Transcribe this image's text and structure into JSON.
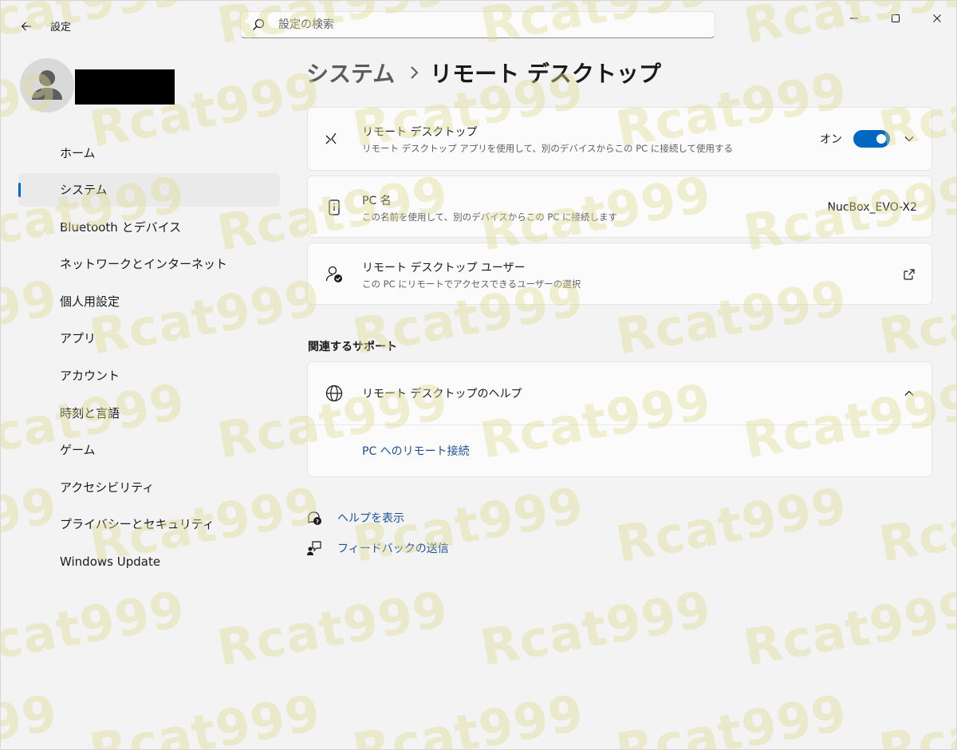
{
  "window": {
    "title": "設定"
  },
  "search": {
    "placeholder": "設定の検索"
  },
  "profile": {
    "name": ""
  },
  "sidebar": {
    "items": [
      {
        "label": "ホーム"
      },
      {
        "label": "システム",
        "selected": true
      },
      {
        "label": "Bluetooth とデバイス"
      },
      {
        "label": "ネットワークとインターネット"
      },
      {
        "label": "個人用設定"
      },
      {
        "label": "アプリ"
      },
      {
        "label": "アカウント"
      },
      {
        "label": "時刻と言語"
      },
      {
        "label": "ゲーム"
      },
      {
        "label": "アクセシビリティ"
      },
      {
        "label": "プライバシーとセキュリティ"
      },
      {
        "label": "Windows Update"
      }
    ]
  },
  "breadcrumb": {
    "parent": "システム",
    "current": "リモート デスクトップ"
  },
  "settings": {
    "remote_desktop": {
      "title": "リモート デスクトップ",
      "description": "リモート デスクトップ アプリを使用して、別のデバイスからこの PC に接続して使用する",
      "toggle_label": "オン",
      "enabled": true
    },
    "pc_name": {
      "title": "PC 名",
      "description": "この名前を使用して、別のデバイスからこの PC に接続します",
      "value": "NucBox_EVO-X2"
    },
    "users": {
      "title": "リモート デスクトップ ユーザー",
      "description": "この PC にリモートでアクセスできるユーザーの選択"
    }
  },
  "support": {
    "section_title": "関連するサポート",
    "help_title": "リモート デスクトップのヘルプ",
    "links": [
      "PC へのリモート接続"
    ]
  },
  "footer": {
    "help": "ヘルプを表示",
    "feedback": "フィードバックの送信"
  },
  "watermark": {
    "text": "Rcat999",
    "color": "#dedc96"
  },
  "colors": {
    "accent": "#0067c0",
    "link": "#1f4f8f"
  }
}
